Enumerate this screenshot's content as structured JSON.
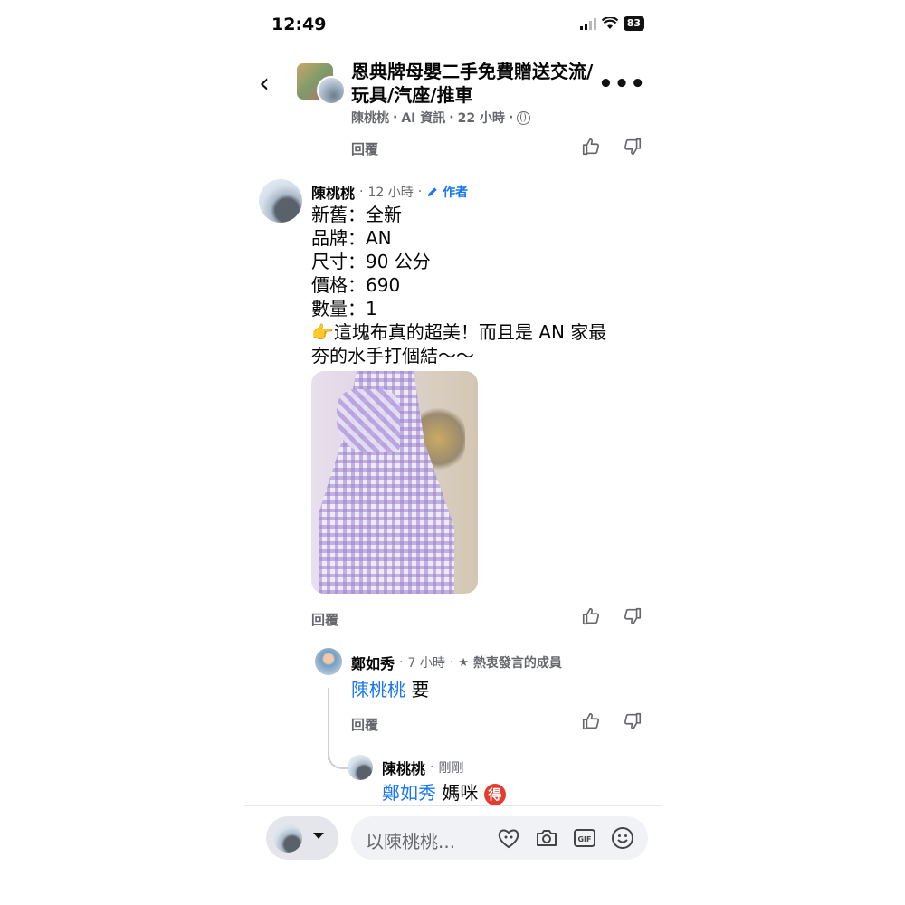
{
  "status_bar": {
    "time": "12:49",
    "battery": "83"
  },
  "header": {
    "title": "恩典牌母嬰二手免費贈送交流/玩具/汽座/推車",
    "subtitle_author": "陳桃桃",
    "subtitle_ai": "AI 資訊",
    "subtitle_time": "22 小時",
    "sep": "·"
  },
  "top_actions": {
    "reply": "回覆"
  },
  "comment": {
    "author": "陳桃桃",
    "time": "12 小時",
    "author_badge": "作者",
    "lines": [
      "新舊：全新",
      "品牌：AN",
      "尺寸：90 公分",
      "價格：690",
      "數量：1",
      "👉這塊布真的超美！而且是 AN 家最",
      "夯的水手打個結～～"
    ],
    "reply": "回覆"
  },
  "reply1": {
    "author": "鄭如秀",
    "time": "7 小時",
    "badge": "熱衷發言的成員",
    "mention": "陳桃桃",
    "text": "要",
    "reply": "回覆"
  },
  "reply2": {
    "author": "陳桃桃",
    "time": "剛剛",
    "mention": "鄭如秀",
    "text": "媽咪",
    "emoji": "得"
  },
  "composer": {
    "placeholder": "以陳桃桃..."
  },
  "icons": [
    "chevron-left-icon",
    "more-icon",
    "globe-icon",
    "like-icon",
    "dislike-icon",
    "pencil-icon",
    "star-icon",
    "avatar-sticker-icon",
    "camera-icon",
    "gif-icon",
    "emoji-icon"
  ]
}
